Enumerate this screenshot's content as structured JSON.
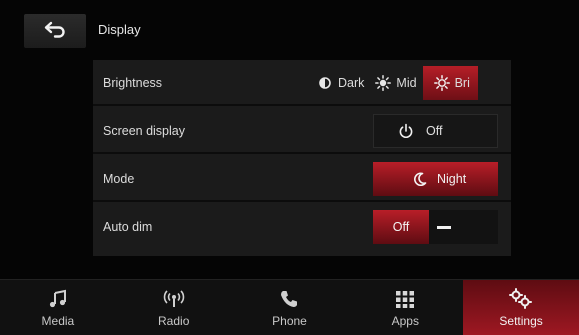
{
  "header": {
    "title": "Display",
    "back_icon": "back-arrow-icon"
  },
  "settings": {
    "brightness": {
      "label": "Brightness",
      "options": [
        {
          "label": "Dark",
          "icon": "half-circle-icon",
          "active": false
        },
        {
          "label": "Mid",
          "icon": "sun-icon",
          "active": false
        },
        {
          "label": "Bri",
          "icon": "sun-icon",
          "active": true
        }
      ]
    },
    "screen_display": {
      "label": "Screen display",
      "value": "Off",
      "icon": "power-icon"
    },
    "mode": {
      "label": "Mode",
      "value": "Night",
      "icon": "moon-icon"
    },
    "auto_dim": {
      "label": "Auto dim",
      "value": "Off",
      "icon": "minus-icon"
    }
  },
  "nav": [
    {
      "label": "Media",
      "icon": "music-note-icon",
      "active": false
    },
    {
      "label": "Radio",
      "icon": "radio-signal-icon",
      "active": false
    },
    {
      "label": "Phone",
      "icon": "phone-icon",
      "active": false
    },
    {
      "label": "Apps",
      "icon": "apps-grid-icon",
      "active": false
    },
    {
      "label": "Settings",
      "icon": "gears-icon",
      "active": true
    }
  ],
  "colors": {
    "accent": "#b51e27",
    "panel": "#1b1b1b",
    "background": "#050505"
  }
}
